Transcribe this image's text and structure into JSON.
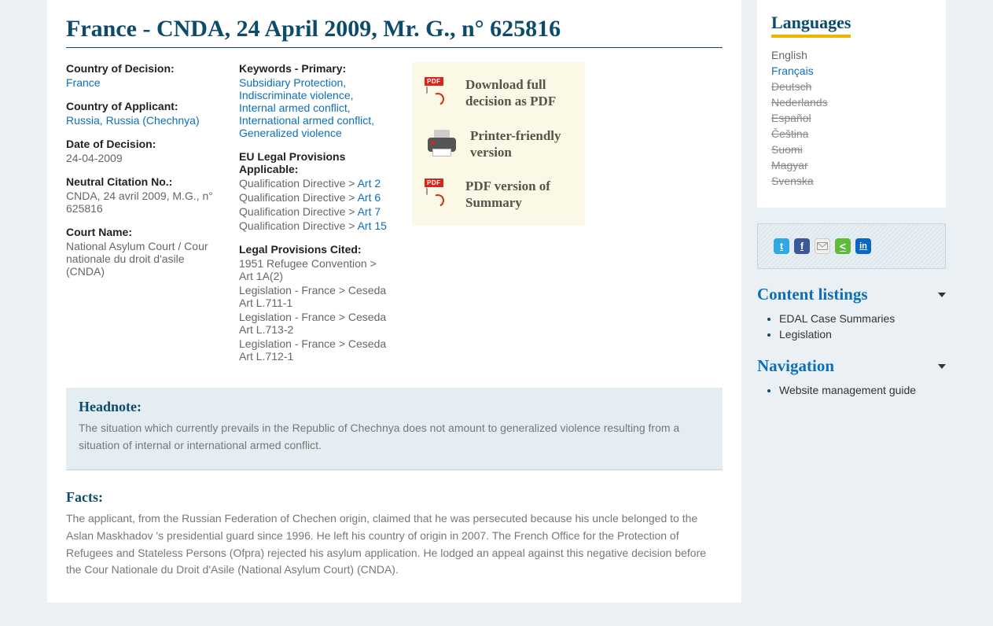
{
  "page_title": "France - CNDA, 24 April 2009, Mr. G., n° 625816",
  "meta": {
    "country_decision": {
      "label": "Country of Decision:",
      "value": "France"
    },
    "country_applicant": {
      "label": "Country of Applicant:",
      "values": [
        "Russia",
        "Russia (Chechnya)"
      ]
    },
    "date_decision": {
      "label": "Date of Decision:",
      "value": "24-04-2009"
    },
    "neutral_citation": {
      "label": "Neutral Citation No.:",
      "value": "CNDA, 24 avril 2009, M.G., n° 625816"
    },
    "court_name": {
      "label": "Court Name:",
      "value": "National Asylum Court / Cour nationale du droit d'asile (CNDA)"
    },
    "keywords_primary": {
      "label": "Keywords - Primary:",
      "values": [
        "Subsidiary Protection",
        "Indiscriminate violence",
        "Internal armed conflict",
        "International armed conflict",
        "Generalized violence"
      ]
    },
    "eu_provisions": {
      "label": "EU Legal Provisions Applicable:",
      "items": [
        {
          "prefix": "Qualification Directive > ",
          "link": "Art 2"
        },
        {
          "prefix": "Qualification Directive > ",
          "link": "Art 6"
        },
        {
          "prefix": "Qualification Directive > ",
          "link": "Art 7"
        },
        {
          "prefix": "Qualification Directive > ",
          "link": "Art 15"
        }
      ]
    },
    "legal_provisions_cited": {
      "label": "Legal Provisions Cited:",
      "items": [
        "1951 Refugee Convention > Art 1A(2)",
        "Legislation - France > Ceseda Art L.711-1",
        "Legislation - France > Ceseda Art L.713-2",
        "Legislation - France > Ceseda Art L.712-1"
      ]
    }
  },
  "downloads": {
    "pdf_full": "Download full decision as PDF",
    "print": "Printer-friendly version",
    "pdf_summary": "PDF version of Summary",
    "pdf_badge": "PDF"
  },
  "headnote": {
    "heading": "Headnote:",
    "text": "The situation which currently prevails in the Republic of Chechnya does not amount to generalized violence resulting from a situation of internal or international armed conflict."
  },
  "facts": {
    "heading": "Facts:",
    "text": "The applicant, from the Russian Federation of Chechen origin, claimed that he was persecuted because his uncle belonged to the Aslan Maskhadov 's  presidential guard since 1996. He left his country of origin in 2007. The French Office for the Protection of Refugees and Stateless Persons (Ofpra) rejected his asylum application. He lodged an appeal against this negative decision before the Cour Nationale du Droit d'Asile (National Asylum Court) (CNDA)."
  },
  "sidebar": {
    "languages_heading": "Languages",
    "languages": [
      {
        "label": "English",
        "state": "normal"
      },
      {
        "label": "Français",
        "state": "active"
      },
      {
        "label": "Deutsch",
        "state": "disabled"
      },
      {
        "label": "Nederlands",
        "state": "disabled"
      },
      {
        "label": "Español",
        "state": "disabled"
      },
      {
        "label": "Čeština",
        "state": "disabled"
      },
      {
        "label": "Suomi",
        "state": "disabled"
      },
      {
        "label": "Magyar",
        "state": "disabled"
      },
      {
        "label": "Svenska",
        "state": "disabled"
      }
    ],
    "content_listings": {
      "heading": "Content listings",
      "items": [
        "EDAL Case Summaries",
        "Legislation"
      ]
    },
    "navigation": {
      "heading": "Navigation",
      "items": [
        "Website management guide"
      ]
    }
  }
}
